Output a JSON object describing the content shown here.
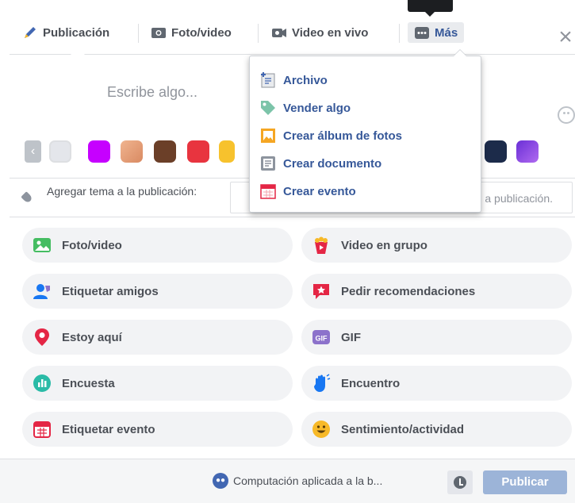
{
  "colors": {
    "accent": "#365899",
    "publish_bg": "#9cb4d8",
    "tab_text": "#4b4f56"
  },
  "tabs": [
    {
      "label": "Publicación",
      "icon": "pencil-icon"
    },
    {
      "label": "Foto/video",
      "icon": "camera-icon"
    },
    {
      "label": "Video en vivo",
      "icon": "video-camera-icon"
    },
    {
      "label": "Más",
      "icon": "more-dots-icon"
    }
  ],
  "composer": {
    "placeholder": "Escribe algo..."
  },
  "swatches": [
    "#e4e6eb",
    "#c600ff",
    "#e8a37e",
    "#6b3f28",
    "#e8343f",
    "#f7c22d",
    "#1c2b4a",
    "#8b45d6"
  ],
  "topic": {
    "label": "Agregar tema a la publicación:",
    "input_placeholder_visible": "a publicación."
  },
  "menu": {
    "items": [
      {
        "label": "Archivo",
        "icon": "file-upload-icon"
      },
      {
        "label": "Vender algo",
        "icon": "price-tag-icon"
      },
      {
        "label": "Crear álbum de fotos",
        "icon": "photo-album-icon"
      },
      {
        "label": "Crear documento",
        "icon": "document-icon"
      },
      {
        "label": "Crear evento",
        "icon": "calendar-icon"
      }
    ]
  },
  "actions": [
    {
      "label": "Foto/video",
      "icon": "photo-icon",
      "color": "#45bd62"
    },
    {
      "label": "Video en grupo",
      "icon": "popcorn-icon",
      "color": "#e42645"
    },
    {
      "label": "Etiquetar amigos",
      "icon": "tag-friends-icon",
      "color": "#1877f2"
    },
    {
      "label": "Pedir recomendaciones",
      "icon": "recommendation-icon",
      "color": "#e42645"
    },
    {
      "label": "Estoy aquí",
      "icon": "location-pin-icon",
      "color": "#e42645"
    },
    {
      "label": "GIF",
      "icon": "gif-icon",
      "color": "#8c72cb"
    },
    {
      "label": "Encuesta",
      "icon": "poll-icon",
      "color": "#2abba7"
    },
    {
      "label": "Encuentro",
      "icon": "wave-hand-icon",
      "color": "#1877f2"
    },
    {
      "label": "Etiquetar evento",
      "icon": "event-calendar-icon",
      "color": "#e42645"
    },
    {
      "label": "Sentimiento/actividad",
      "icon": "smiley-icon",
      "color": "#f7b928"
    }
  ],
  "footer": {
    "audience": "Computación aplicada a la b...",
    "publish": "Publicar"
  }
}
